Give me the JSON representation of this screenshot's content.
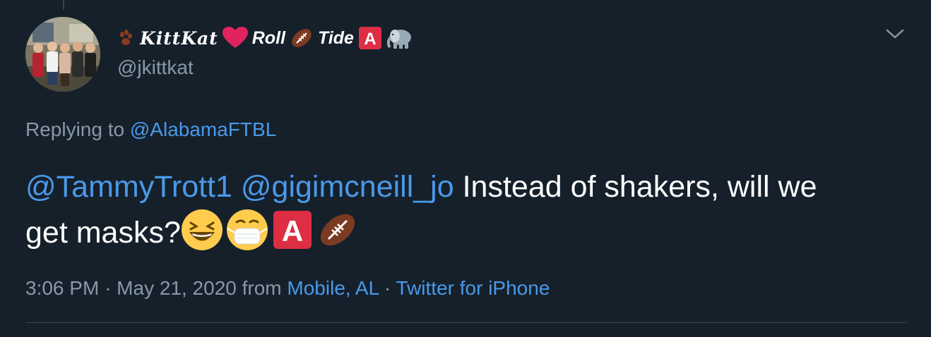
{
  "tweet": {
    "display_name": {
      "prefix_emoji": "paw-prints",
      "script_text": "𝑲𝒊𝒕𝒕𝑲𝒂𝒕",
      "heart_emoji": "red-heart",
      "word1": "Roll",
      "football_emoji": "american-football",
      "word2": "Tide",
      "letter_badge": "A",
      "elephant_emoji": "elephant"
    },
    "handle": "@jkittkat",
    "replying_prefix": "Replying to",
    "replying_to": "@AlabamaFTBL",
    "mention1": "@TammyTrott1",
    "mention2": "@gigimcneill_jo",
    "body_line1_text": "Instead of shakers, will we",
    "body_line2_text": "get masks?",
    "body_emojis": [
      "grinning-squinting-face",
      "face-with-medical-mask",
      "a-button-blood-type",
      "american-football"
    ],
    "time": "3:06 PM",
    "separator": "·",
    "date": "May 21, 2020",
    "from_label": "from",
    "location": "Mobile, AL",
    "client": "Twitter for iPhone"
  },
  "icons": {
    "more_menu": "chevron-down-icon"
  },
  "colors": {
    "background": "#15202b",
    "text_primary": "#ffffff",
    "text_secondary": "#8899a6",
    "link": "#1da1f2",
    "divider": "#38444d"
  }
}
